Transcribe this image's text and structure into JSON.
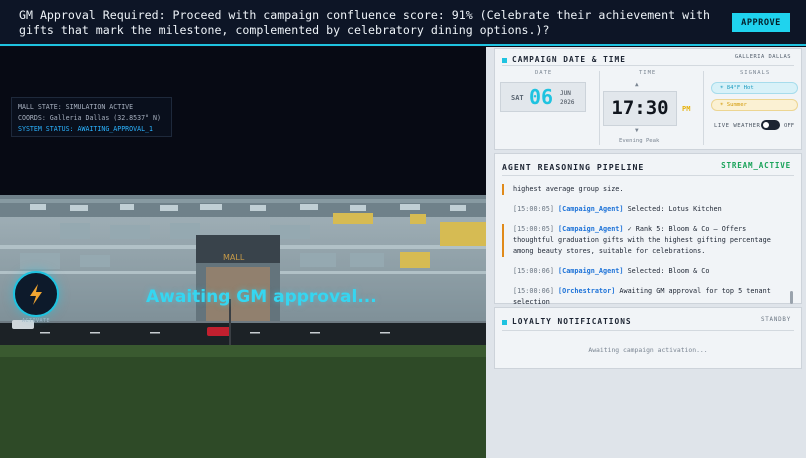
{
  "banner": {
    "message": "GM Approval Required: Proceed with campaign confluence score: 91% (Celebrate their achievement with gifts that mark the milestone, complemented by celebratory dining options.)?",
    "approve_label": "APPROVE"
  },
  "scene": {
    "hud_line1": "MALL STATE: SIMULATION ACTIVE",
    "hud_line2": "COORDS: Galleria Dallas (32.8537° N)",
    "hud_line3": "SYSTEM STATUS: AWAITING_APPROVAL_1",
    "overlay": "Awaiting GM approval...",
    "mall_sign": "MALL",
    "activate_label": "ACTIVATE"
  },
  "campaign": {
    "title": "CAMPAIGN DATE & TIME",
    "location": "GALLERIA DALLAS",
    "date_label": "DATE",
    "dow": "SAT",
    "day": "06",
    "month": "JUN",
    "year": "2026",
    "time_label": "TIME",
    "time": "17:30",
    "ampm": "PM",
    "peak": "Evening Peak",
    "signals_label": "SIGNALS",
    "signal_hot": "84°F Hot",
    "signal_summer": "Summer",
    "live_weather": "LIVE WEATHER",
    "toggle_state": "OFF"
  },
  "pipeline": {
    "title": "AGENT REASONING PIPELINE",
    "status": "STREAM_ACTIVE",
    "entries": [
      {
        "ts": "",
        "agent": "",
        "text": "highest average group size."
      },
      {
        "ts": "[15:00:05]",
        "agent": "[Campaign_Agent]",
        "text": " Selected: Lotus Kitchen"
      },
      {
        "ts": "[15:00:05]",
        "agent": "[Campaign_Agent]",
        "text": " ✓ Rank 5: Bloom & Co – Offers thoughtful graduation gifts with the highest gifting percentage among beauty stores, suitable for celebrations."
      },
      {
        "ts": "[15:00:06]",
        "agent": "[Campaign_Agent]",
        "text": " Selected: Bloom & Co"
      },
      {
        "ts": "[15:00:06]",
        "agent": "[Orchestrator]",
        "text": " Awaiting GM approval for top 5 tenant selection"
      }
    ]
  },
  "loyalty": {
    "title": "LOYALTY NOTIFICATIONS",
    "status": "STANDBY",
    "waiting": "Awaiting campaign activation..."
  },
  "colors": {
    "accent": "#1fc3e0",
    "stream_active": "#1aa35a",
    "agent": "#1e73d8",
    "pm": "#e7b10a"
  }
}
